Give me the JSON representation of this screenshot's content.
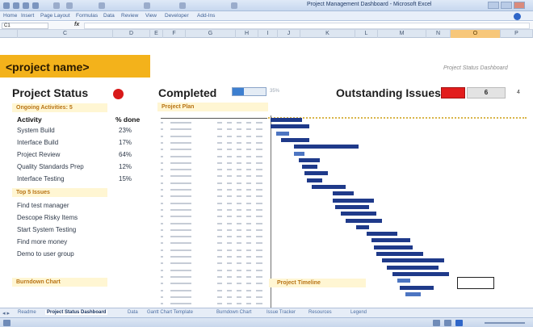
{
  "window": {
    "title": "Project Management Dashboard - Microsoft Excel"
  },
  "ribbon": {
    "tabs": [
      "Home",
      "Insert",
      "Page Layout",
      "Formulas",
      "Data",
      "Review",
      "View",
      "Developer",
      "Add-Ins"
    ]
  },
  "formula_bar": {
    "name_box": "C1",
    "fx_label": "fx",
    "value": ""
  },
  "columns": [
    "C",
    "D",
    "E",
    "F",
    "G",
    "H",
    "I",
    "J",
    "K",
    "L",
    "M",
    "N",
    "O",
    "P"
  ],
  "dashboard": {
    "project_name": "<project name>",
    "subtitle": "Project Status Dashboard",
    "project_status_title": "Project Status",
    "status_color": "#d81919",
    "completed_title": "Completed",
    "completed_pct": 35,
    "completed_pct_label": "35%",
    "outstanding_title": "Outstanding Issues",
    "outstanding_red": "",
    "outstanding_count": "6",
    "outstanding_side": "4"
  },
  "activities": {
    "section_label": "Ongoing Activities: 5",
    "col_activity": "Activity",
    "col_done": "% done",
    "rows": [
      {
        "name": "System Build",
        "pct": "23%"
      },
      {
        "name": "Interface Build",
        "pct": "17%"
      },
      {
        "name": "Project Review",
        "pct": "64%"
      },
      {
        "name": "Quality Standards Prep",
        "pct": "12%"
      },
      {
        "name": "Interface Testing",
        "pct": "15%"
      }
    ]
  },
  "issues": {
    "section_label": "Top 5 Issues",
    "items": [
      "Find test manager",
      "Descope Risky Items",
      "Start System Testing",
      "Find more money",
      "Demo to user group"
    ]
  },
  "plan": {
    "section_label": "Project Plan",
    "row_count": 28
  },
  "gantt": {
    "bars": [
      {
        "start": 0.01,
        "end": 0.13,
        "row": 0,
        "light": false
      },
      {
        "start": 0.01,
        "end": 0.16,
        "row": 1,
        "light": false
      },
      {
        "start": 0.03,
        "end": 0.08,
        "row": 2,
        "light": true
      },
      {
        "start": 0.05,
        "end": 0.16,
        "row": 3,
        "light": false
      },
      {
        "start": 0.1,
        "end": 0.35,
        "row": 4,
        "light": false
      },
      {
        "start": 0.1,
        "end": 0.14,
        "row": 5,
        "light": true
      },
      {
        "start": 0.12,
        "end": 0.2,
        "row": 6,
        "light": false
      },
      {
        "start": 0.13,
        "end": 0.19,
        "row": 7,
        "light": false
      },
      {
        "start": 0.14,
        "end": 0.23,
        "row": 8,
        "light": false
      },
      {
        "start": 0.15,
        "end": 0.21,
        "row": 9,
        "light": false
      },
      {
        "start": 0.17,
        "end": 0.3,
        "row": 10,
        "light": false
      },
      {
        "start": 0.25,
        "end": 0.33,
        "row": 11,
        "light": false
      },
      {
        "start": 0.25,
        "end": 0.41,
        "row": 12,
        "light": false
      },
      {
        "start": 0.26,
        "end": 0.39,
        "row": 13,
        "light": false
      },
      {
        "start": 0.28,
        "end": 0.42,
        "row": 14,
        "light": false
      },
      {
        "start": 0.3,
        "end": 0.44,
        "row": 15,
        "light": false
      },
      {
        "start": 0.34,
        "end": 0.39,
        "row": 16,
        "light": false
      },
      {
        "start": 0.38,
        "end": 0.5,
        "row": 17,
        "light": false
      },
      {
        "start": 0.4,
        "end": 0.55,
        "row": 18,
        "light": false
      },
      {
        "start": 0.41,
        "end": 0.56,
        "row": 19,
        "light": false
      },
      {
        "start": 0.42,
        "end": 0.6,
        "row": 20,
        "light": false
      },
      {
        "start": 0.44,
        "end": 0.68,
        "row": 21,
        "light": false
      },
      {
        "start": 0.46,
        "end": 0.66,
        "row": 22,
        "light": false
      },
      {
        "start": 0.48,
        "end": 0.7,
        "row": 23,
        "light": false
      },
      {
        "start": 0.5,
        "end": 0.55,
        "row": 24,
        "light": true
      },
      {
        "start": 0.51,
        "end": 0.64,
        "row": 25,
        "light": false
      },
      {
        "start": 0.53,
        "end": 0.59,
        "row": 26,
        "light": true
      }
    ]
  },
  "bottom": {
    "burndown_label": "Burndown Chart",
    "timeline_label": "Project Timeline"
  },
  "sheet_tabs": {
    "nav": "◂ ▸",
    "tabs": [
      "Readme",
      "Project Status Dashboard",
      "Data",
      "Gantt Chart Template",
      "Burndown Chart",
      "Issue Tracker",
      "Resources",
      "Legend"
    ],
    "active_index": 1
  }
}
